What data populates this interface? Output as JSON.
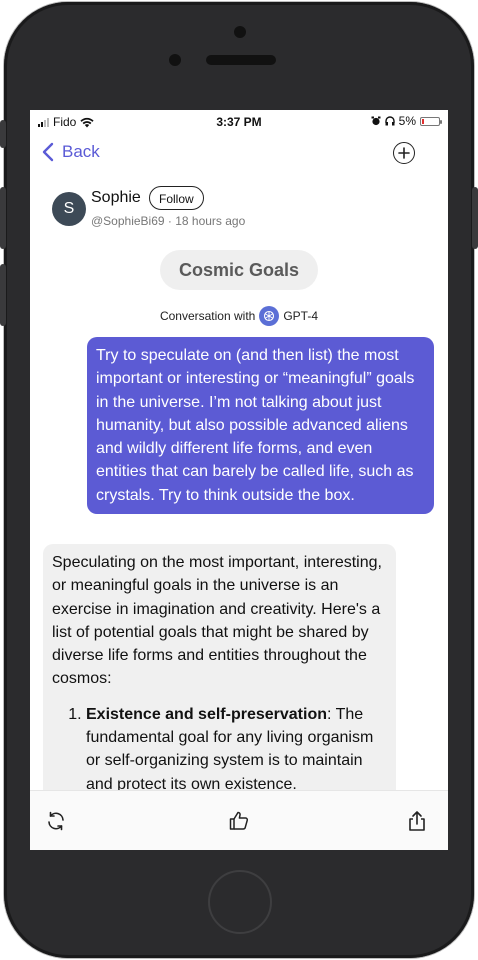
{
  "status_bar": {
    "carrier": "Fido",
    "time": "3:37 PM",
    "battery_percent": "5%"
  },
  "header": {
    "back_label": "Back"
  },
  "author": {
    "avatar_initial": "S",
    "name": "Sophie",
    "follow_label": "Follow",
    "handle_time": "@SophieBi69 · 18 hours ago"
  },
  "conversation": {
    "title": "Cosmic Goals",
    "with_label": "Conversation with",
    "model": "GPT-4",
    "user_message": "Try to speculate on (and then list) the most important or interesting or “meaningful” goals in the universe. I’m not talking about just humanity, but also possible advanced aliens and wildly different life forms, and even entities that can barely be called life, such as crystals. Try to think outside the box.",
    "bot_intro": "Speculating on the most important, interesting, or meaningful goals in the universe is an exercise in imagination and creativity. Here's a list of potential goals that might be shared by diverse life forms and entities throughout the cosmos:",
    "bot_list": [
      {
        "title": "Existence and self-preservation",
        "text": ": The fundamental goal for any living organism or self-organizing system is to maintain and protect its own existence."
      }
    ]
  },
  "toolbar": {
    "icons": [
      "refresh-icon",
      "thumbs-up-icon",
      "share-icon"
    ]
  },
  "colors": {
    "accent": "#5c5bd4",
    "bubble_bot": "#f0f0f0",
    "phone_body": "#2b2b2d"
  }
}
